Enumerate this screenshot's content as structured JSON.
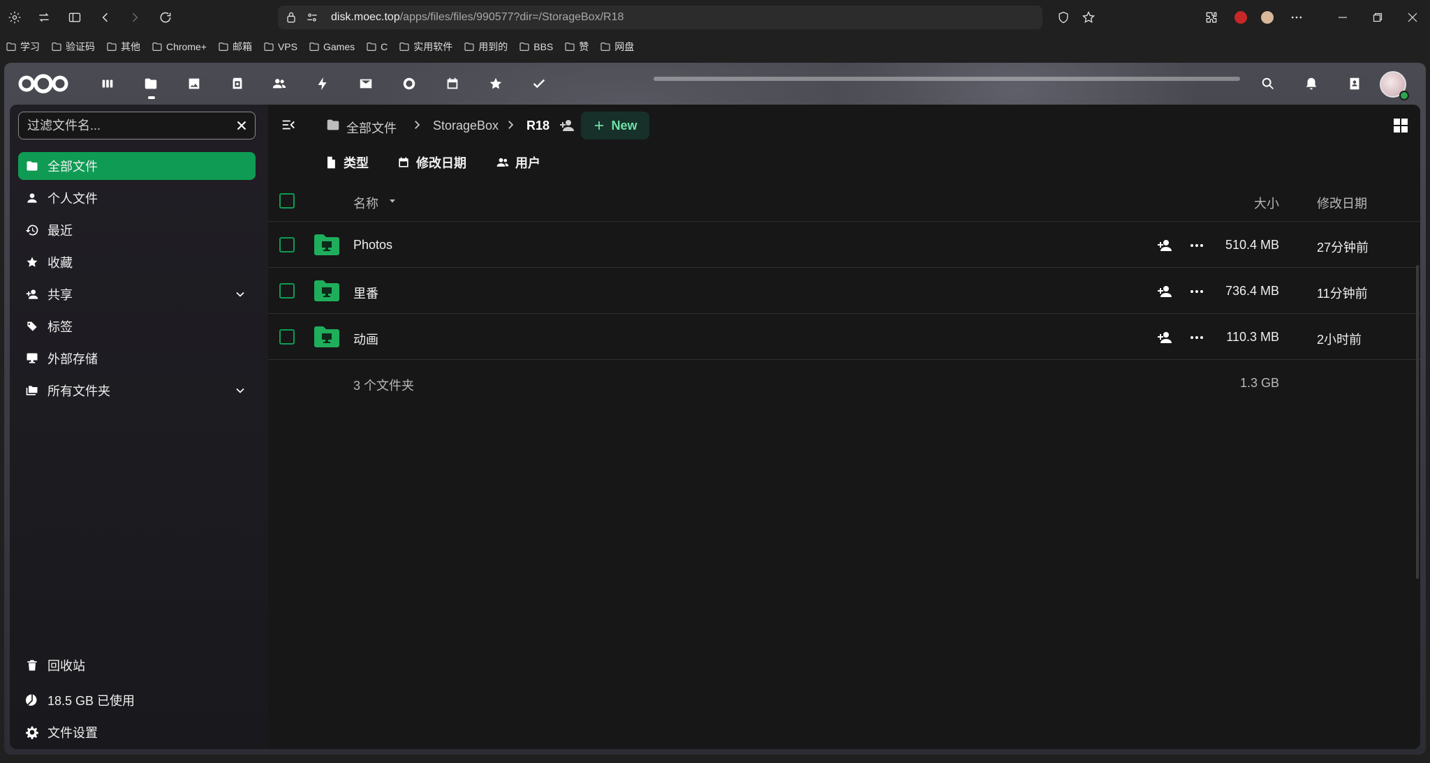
{
  "browser": {
    "url_host": "disk.moec.top",
    "url_path": "/apps/files/files/990577?dir=/StorageBox/R18",
    "url_prefix": "",
    "bookmarks": [
      "学习",
      "验证码",
      "其他",
      "Chrome+",
      "邮箱",
      "VPS",
      "Games",
      "C",
      "实用软件",
      "用到的",
      "BBS",
      "赞",
      "网盘"
    ]
  },
  "topnav": {
    "apps": [
      "dashboard-icon",
      "files-icon",
      "photos-icon",
      "deck-icon",
      "contacts-icon",
      "activity-icon",
      "mail-icon",
      "talk-icon",
      "calendar-icon",
      "favorites-icon",
      "tasks-icon"
    ]
  },
  "sidebar": {
    "filter_placeholder": "过滤文件名...",
    "items": [
      {
        "label": "全部文件"
      },
      {
        "label": "个人文件"
      },
      {
        "label": "最近"
      },
      {
        "label": "收藏"
      },
      {
        "label": "共享"
      },
      {
        "label": "标签"
      },
      {
        "label": "外部存储"
      },
      {
        "label": "所有文件夹"
      }
    ],
    "trash": "回收站",
    "quota": "18.5 GB 已使用",
    "settings": "文件设置"
  },
  "breadcrumb": {
    "items": [
      "全部文件",
      "StorageBox",
      "R18"
    ],
    "new_label": "New"
  },
  "filters": {
    "type": "类型",
    "modified": "修改日期",
    "people": "用户"
  },
  "table": {
    "col_name": "名称",
    "col_size": "大小",
    "col_modified": "修改日期",
    "rows": [
      {
        "name": "Photos",
        "size": "510.4 MB",
        "modified": "27分钟前"
      },
      {
        "name": "里番",
        "size": "736.4 MB",
        "modified": "11分钟前"
      },
      {
        "name": "动画",
        "size": "110.3 MB",
        "modified": "2小时前"
      }
    ],
    "summary_count": "3 个文件夹",
    "summary_size": "1.3 GB"
  },
  "colors": {
    "accent": "#0f9b54",
    "folder": "#1fae5b"
  }
}
